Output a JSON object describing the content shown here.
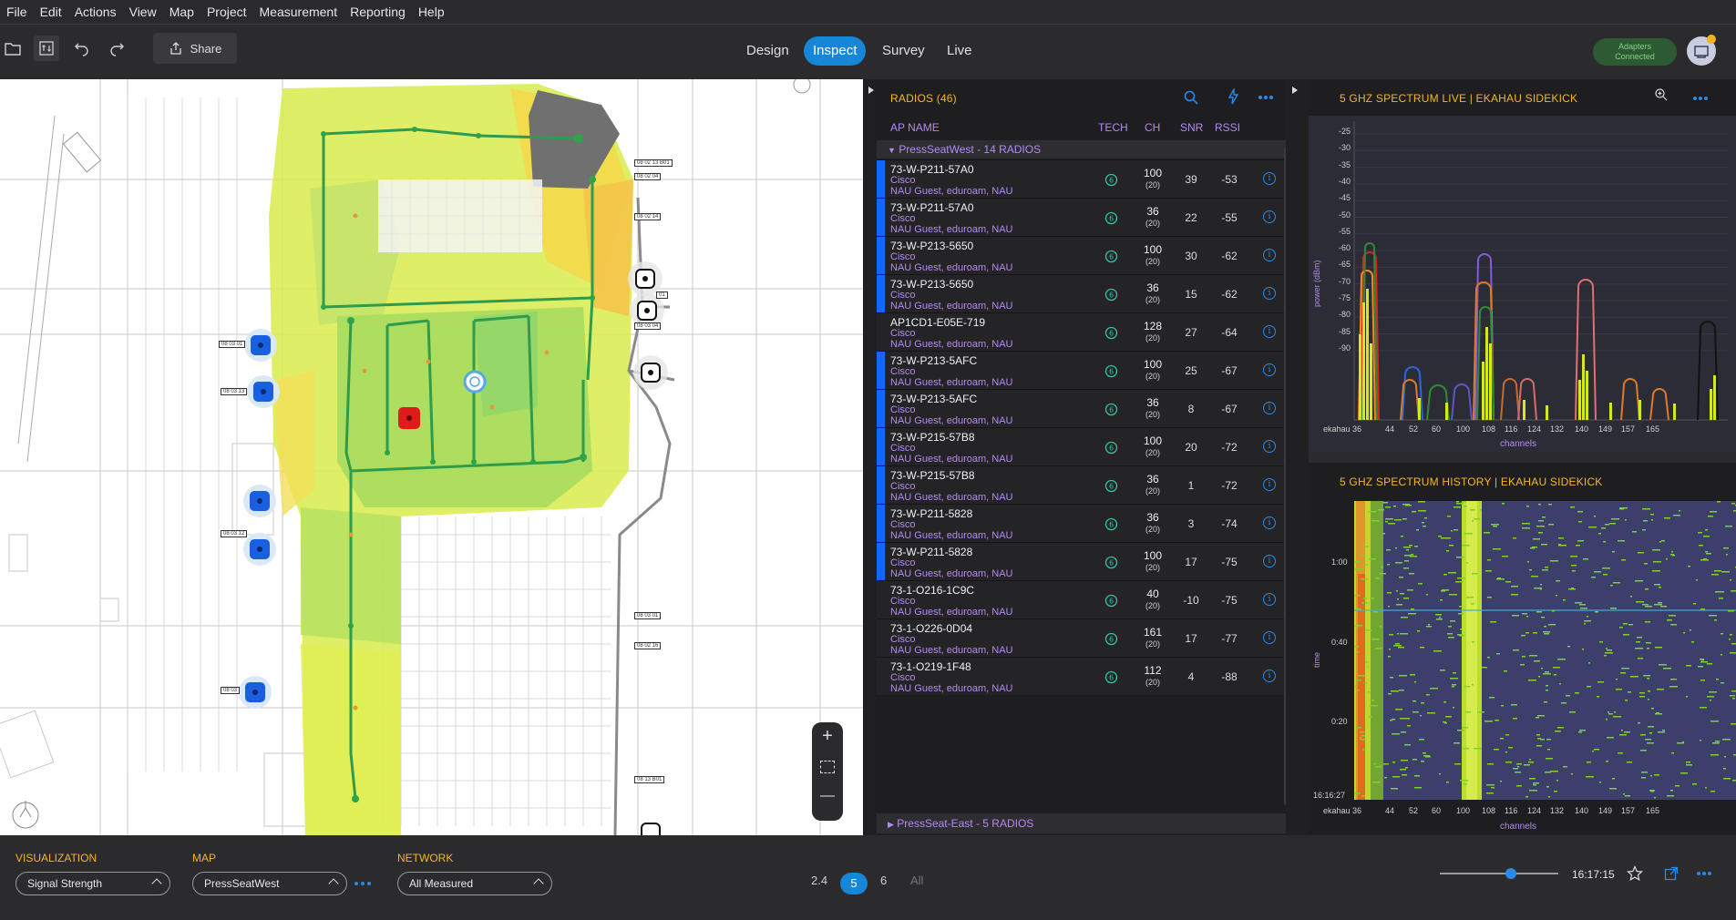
{
  "menu": [
    "File",
    "Edit",
    "Actions",
    "View",
    "Map",
    "Project",
    "Measurement",
    "Reporting",
    "Help"
  ],
  "toolbar": {
    "share_label": "Share"
  },
  "modes": [
    {
      "label": "Design",
      "active": false
    },
    {
      "label": "Inspect",
      "active": true
    },
    {
      "label": "Survey",
      "active": false
    },
    {
      "label": "Live",
      "active": false
    }
  ],
  "adapters": {
    "line1": "Adapters",
    "line2": "Connected"
  },
  "map": {
    "ap_labels": [
      "08 03 01",
      "08 03 13",
      "08 03 12",
      "08 03",
      "08 02 13 B01",
      "08 02 04",
      "08 02 14",
      "01",
      "08 03 04",
      "08 03 01",
      "08 02 16",
      "08 13 B01"
    ],
    "zoom_in": "+",
    "zoom_out": "—"
  },
  "radios": {
    "title": "RADIOS (46)",
    "columns": {
      "name": "AP NAME",
      "tech": "TECH",
      "ch": "CH",
      "snr": "SNR",
      "rssi": "RSSI"
    },
    "group_open": "PressSeatWest - 14 RADIOS",
    "group_closed": "PressSeat-East - 5 RADIOS",
    "rows": [
      {
        "name": "73-W-P211-57A0",
        "vendor": "Cisco",
        "ssids": "NAU Guest, eduroam, NAU",
        "ch": "100",
        "width": "(20)",
        "snr": "39",
        "rssi": "-53",
        "bar": true
      },
      {
        "name": "73-W-P211-57A0",
        "vendor": "Cisco",
        "ssids": "NAU Guest, eduroam, NAU",
        "ch": "36",
        "width": "(20)",
        "snr": "22",
        "rssi": "-55",
        "bar": true
      },
      {
        "name": "73-W-P213-5650",
        "vendor": "Cisco",
        "ssids": "NAU Guest, eduroam, NAU",
        "ch": "100",
        "width": "(20)",
        "snr": "30",
        "rssi": "-62",
        "bar": true
      },
      {
        "name": "73-W-P213-5650",
        "vendor": "Cisco",
        "ssids": "NAU Guest, eduroam, NAU",
        "ch": "36",
        "width": "(20)",
        "snr": "15",
        "rssi": "-62",
        "bar": true
      },
      {
        "name": "AP1CD1-E05E-719",
        "vendor": "Cisco",
        "ssids": "NAU Guest, eduroam, NAU",
        "ch": "128",
        "width": "(20)",
        "snr": "27",
        "rssi": "-64",
        "bar": false
      },
      {
        "name": "73-W-P213-5AFC",
        "vendor": "Cisco",
        "ssids": "NAU Guest, eduroam, NAU",
        "ch": "100",
        "width": "(20)",
        "snr": "25",
        "rssi": "-67",
        "bar": true
      },
      {
        "name": "73-W-P213-5AFC",
        "vendor": "Cisco",
        "ssids": "NAU Guest, eduroam, NAU",
        "ch": "36",
        "width": "(20)",
        "snr": "8",
        "rssi": "-67",
        "bar": true
      },
      {
        "name": "73-W-P215-57B8",
        "vendor": "Cisco",
        "ssids": "NAU Guest, eduroam, NAU",
        "ch": "100",
        "width": "(20)",
        "snr": "20",
        "rssi": "-72",
        "bar": true
      },
      {
        "name": "73-W-P215-57B8",
        "vendor": "Cisco",
        "ssids": "NAU Guest, eduroam, NAU",
        "ch": "36",
        "width": "(20)",
        "snr": "1",
        "rssi": "-72",
        "bar": true
      },
      {
        "name": "73-W-P211-5828",
        "vendor": "Cisco",
        "ssids": "NAU Guest, eduroam, NAU",
        "ch": "36",
        "width": "(20)",
        "snr": "3",
        "rssi": "-74",
        "bar": true
      },
      {
        "name": "73-W-P211-5828",
        "vendor": "Cisco",
        "ssids": "NAU Guest, eduroam, NAU",
        "ch": "100",
        "width": "(20)",
        "snr": "17",
        "rssi": "-75",
        "bar": true
      },
      {
        "name": "73-1-O216-1C9C",
        "vendor": "Cisco",
        "ssids": "NAU Guest, eduroam, NAU",
        "ch": "40",
        "width": "(20)",
        "snr": "-10",
        "rssi": "-75",
        "bar": false
      },
      {
        "name": "73-1-O226-0D04",
        "vendor": "Cisco",
        "ssids": "NAU Guest, eduroam, NAU",
        "ch": "161",
        "width": "(20)",
        "snr": "17",
        "rssi": "-77",
        "bar": false
      },
      {
        "name": "73-1-O219-1F48",
        "vendor": "Cisco",
        "ssids": "NAU Guest, eduroam, NAU",
        "ch": "112",
        "width": "(20)",
        "snr": "4",
        "rssi": "-88",
        "bar": false
      }
    ]
  },
  "spectrum_live": {
    "title": "5 GHZ SPECTRUM LIVE | EKAHAU SIDEKICK",
    "ylabel": "power (dBm)",
    "xlabel": "channels",
    "yticks": [
      "-25",
      "-30",
      "-35",
      "-40",
      "-45",
      "-50",
      "-55",
      "-60",
      "-65",
      "-70",
      "-75",
      "-80",
      "-85",
      "-90"
    ],
    "xticks": [
      "ekahau 36",
      "44",
      "52",
      "60",
      "100",
      "108",
      "116",
      "124",
      "132",
      "140",
      "149",
      "157",
      "165"
    ]
  },
  "spectrum_history": {
    "title": "5 GHZ SPECTRUM HISTORY | EKAHAU SIDEKICK",
    "ylabel": "time",
    "xlabel": "channels",
    "yticks": [
      "1:00",
      "0:40",
      "0:20",
      "16:16:27"
    ],
    "xticks": [
      "ekahau 36",
      "44",
      "52",
      "60",
      "100",
      "108",
      "116",
      "124",
      "132",
      "140",
      "149",
      "157",
      "165"
    ]
  },
  "bottom": {
    "visualization_label": "VISUALIZATION",
    "visualization_value": "Signal Strength",
    "map_label": "MAP",
    "map_value": "PressSeatWest",
    "network_label": "NETWORK",
    "network_value": "All Measured",
    "bands": [
      "2.4",
      "5",
      "6",
      "All"
    ],
    "active_band": "5",
    "time": "16:17:15",
    "slider_fraction": 0.6
  }
}
